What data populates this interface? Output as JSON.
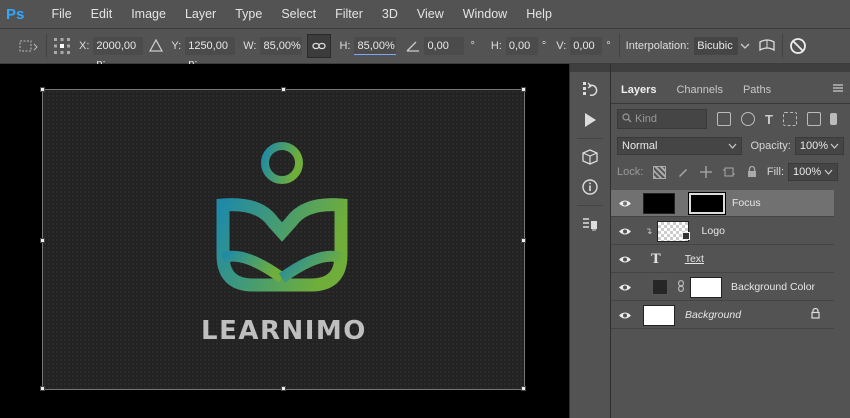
{
  "app": {
    "logo": "Ps"
  },
  "menu": [
    "File",
    "Edit",
    "Image",
    "Layer",
    "Type",
    "Select",
    "Filter",
    "3D",
    "View",
    "Window",
    "Help"
  ],
  "options": {
    "x_label": "X:",
    "x_value": "2000,00 p:",
    "y_label": "Y:",
    "y_value": "1250,00 p:",
    "w_label": "W:",
    "w_value": "85,00%",
    "h_label": "H:",
    "h_value": "85,00%",
    "rotate_value": "0,00",
    "rotate_unit": "°",
    "hskew_label": "H:",
    "hskew_value": "0,00",
    "hskew_unit": "°",
    "vskew_label": "V:",
    "vskew_value": "0,00",
    "vskew_unit": "°",
    "interp_label": "Interpolation:",
    "interp_value": "Bicubic"
  },
  "canvas": {
    "logo_text": "LEARNIMO"
  },
  "panel": {
    "tabs": [
      "Layers",
      "Channels",
      "Paths"
    ],
    "kind_placeholder": "Kind",
    "blend_mode": "Normal",
    "opacity_label": "Opacity:",
    "opacity_value": "100%",
    "lock_label": "Lock:",
    "fill_label": "Fill:",
    "fill_value": "100%"
  },
  "layers": [
    {
      "name": "Focus",
      "selected": true
    },
    {
      "name": "Logo",
      "selected": false
    },
    {
      "name": "Text",
      "selected": false
    },
    {
      "name": "Background Color",
      "selected": false
    },
    {
      "name": "Background",
      "selected": false
    }
  ],
  "colors": {
    "ps_blue": "#31a8ff",
    "logo_teal": "#1f8aa6",
    "logo_green": "#6fae3a",
    "selection_accent": "#7aa7ff"
  }
}
